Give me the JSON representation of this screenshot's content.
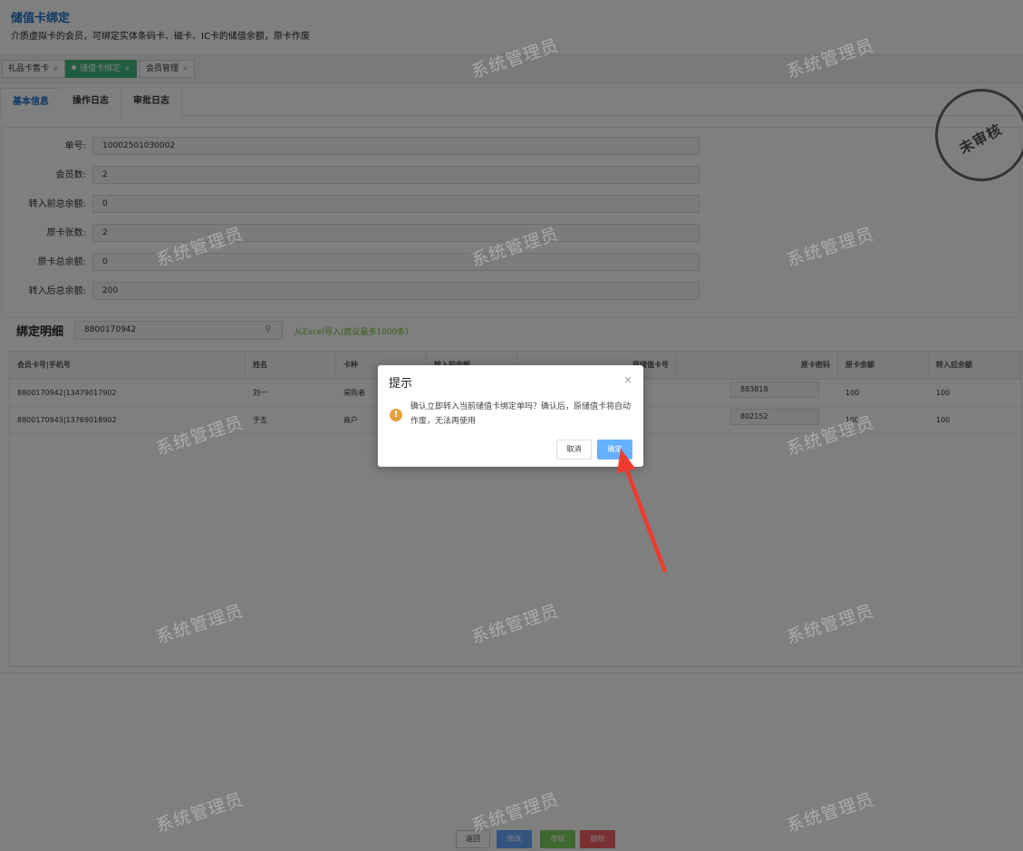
{
  "header": {
    "title": "储值卡绑定",
    "description": "介质虚拟卡的会员，可绑定实体条码卡、磁卡、IC卡的储值余额，原卡作废"
  },
  "tabs": [
    {
      "label": "礼品卡售卡"
    },
    {
      "label": "储值卡绑定"
    },
    {
      "label": "会员管理"
    }
  ],
  "sub_tabs": [
    {
      "label": "基本信息"
    },
    {
      "label": "操作日志"
    },
    {
      "label": "审批日志"
    }
  ],
  "form": {
    "fields": [
      {
        "label": "单号:",
        "value": "10002501030002"
      },
      {
        "label": "会员数:",
        "value": "2"
      },
      {
        "label": "转入前总余额:",
        "value": "0"
      },
      {
        "label": "原卡张数:",
        "value": "2"
      },
      {
        "label": "原卡总余额:",
        "value": "0"
      },
      {
        "label": "转入后总余额:",
        "value": "200"
      }
    ]
  },
  "stamp": {
    "text": "未审核"
  },
  "binding": {
    "title": "绑定明细",
    "search_value": "8800170942",
    "import_link": "从Excel导入(建议最多1000条)",
    "columns": [
      "会员卡号|手机号",
      "姓名",
      "卡种",
      "转入前余额",
      "原储值卡号",
      "原卡密码",
      "原卡余额",
      "转入后余额"
    ],
    "rows": [
      {
        "card_phone": "8800170942|13479017902",
        "name": "刘一",
        "card_type": "采购者",
        "password": "883818",
        "orig_balance": "100",
        "after_balance": "100"
      },
      {
        "card_phone": "8800170943|13769018902",
        "name": "于五",
        "card_type": "商户",
        "password": "802152",
        "orig_balance": "100",
        "after_balance": "100"
      }
    ]
  },
  "bottom_buttons": {
    "back": "返回",
    "edit": "修改",
    "audit": "审核",
    "delete": "删除"
  },
  "watermark": "系统管理员",
  "dialog": {
    "title": "提示",
    "close": "×",
    "message": "确认立即转入当前储值卡绑定单吗？确认后，原储值卡将自动作废，无法再使用",
    "cancel": "取消",
    "confirm": "确定"
  },
  "colors": {
    "accent": "#1f6fc5",
    "active_tab": "#42b983",
    "confirm_button": "#66b1ff",
    "warning_icon": "#e6a23c",
    "arrow": "#f03a2e"
  }
}
